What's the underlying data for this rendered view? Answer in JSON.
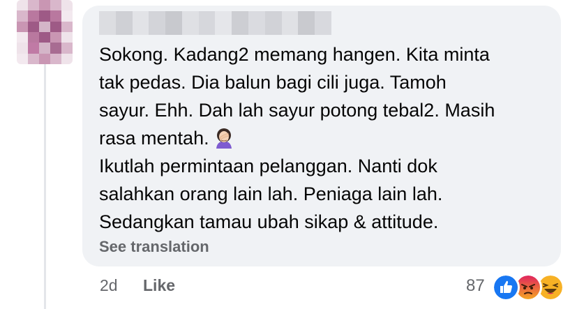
{
  "comment": {
    "text_lines": [
      "Sokong. Kadang2 memang hangen. Kita minta",
      "tak pedas. Dia balun bagi cili juga. Tamoh",
      "sayur. Ehh. Dah lah sayur potong tebal2. Masih",
      "rasa mentah.",
      "Ikutlah permintaan pelanggan. Nanti dok",
      "salahkan orang lain lah. Peniaga lain lah.",
      "Sedangkan tamau ubah sikap & attitude."
    ],
    "inline_emoji": "woman-facepalming-icon",
    "see_translation_label": "See translation"
  },
  "meta": {
    "time": "2d",
    "like_label": "Like",
    "reaction_count": "87",
    "reactions": [
      "like-reaction-icon",
      "angry-reaction-icon",
      "haha-reaction-icon"
    ]
  },
  "colors": {
    "bubble_bg": "#f0f2f5",
    "text": "#050505",
    "secondary_text": "#65676b",
    "like_blue": "#1877f2",
    "angry_orange": "#e9710f",
    "haha_yellow": "#f7b125"
  }
}
